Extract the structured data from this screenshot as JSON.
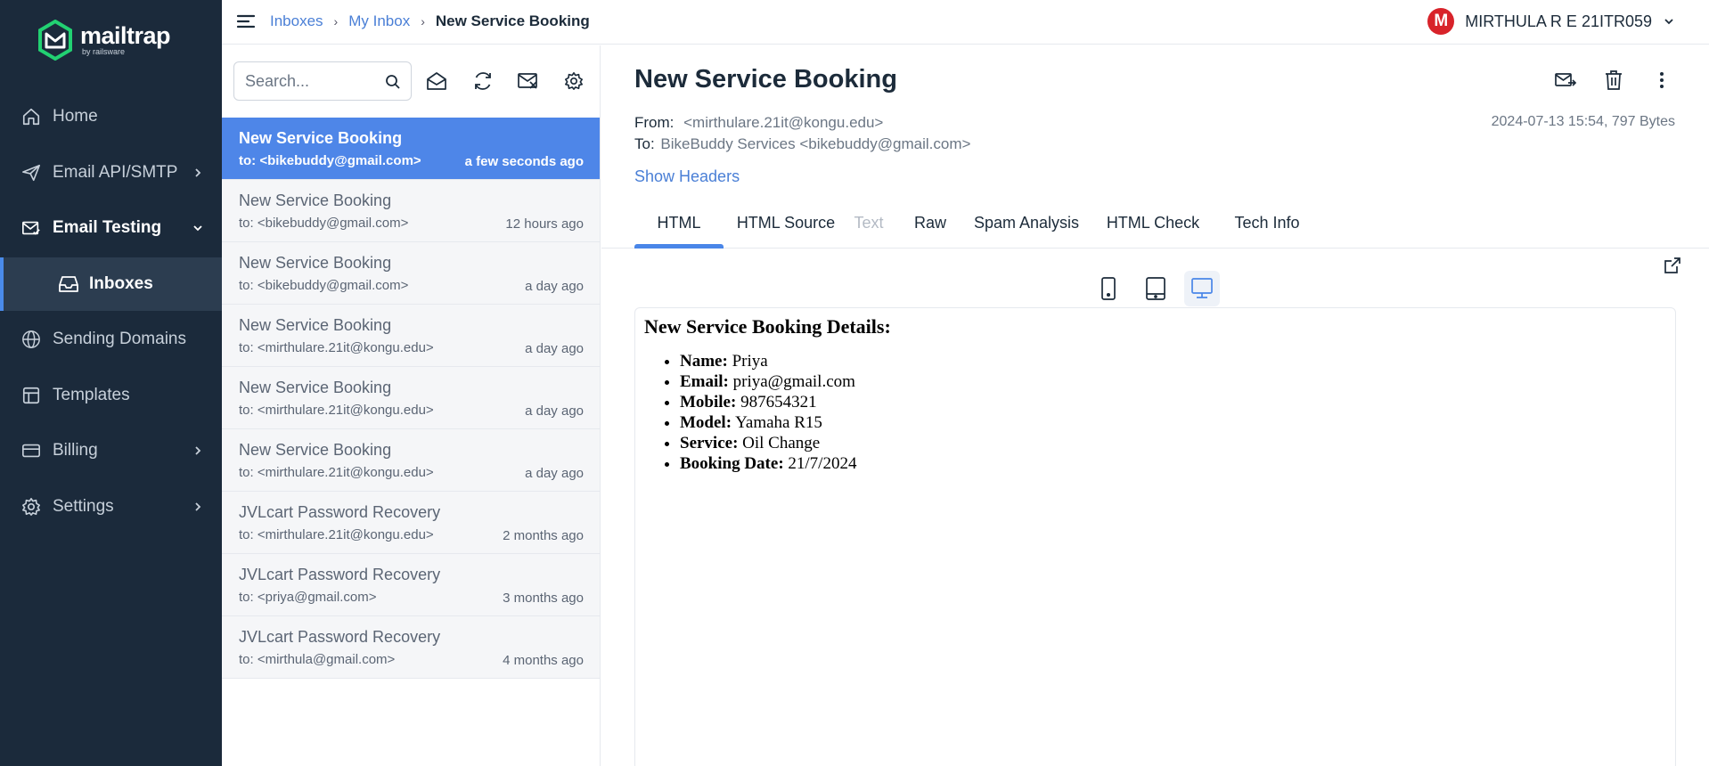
{
  "brand": {
    "name": "mailtrap",
    "sub": "by railsware",
    "color": "#22d172"
  },
  "sidebar": {
    "items": [
      {
        "label": "Home",
        "icon": "home-icon"
      },
      {
        "label": "Email API/SMTP",
        "icon": "send-icon"
      },
      {
        "label": "Email Testing",
        "icon": "mail-check-icon"
      },
      {
        "label": "Inboxes",
        "icon": "inbox-icon"
      },
      {
        "label": "Sending Domains",
        "icon": "globe-icon"
      },
      {
        "label": "Templates",
        "icon": "template-icon"
      },
      {
        "label": "Billing",
        "icon": "card-icon"
      },
      {
        "label": "Settings",
        "icon": "gear-icon"
      }
    ]
  },
  "topbar": {
    "breadcrumb": [
      "Inboxes",
      "My Inbox",
      "New Service Booking"
    ],
    "user": {
      "initial": "M",
      "name": "MIRTHULA R E 21ITR059",
      "avatar_color": "#d8232a"
    }
  },
  "list": {
    "search_placeholder": "Search...",
    "messages": [
      {
        "subject": "New Service Booking",
        "to": "to: <bikebuddy@gmail.com>",
        "time": "a few seconds ago",
        "selected": true
      },
      {
        "subject": "New Service Booking",
        "to": "to: <bikebuddy@gmail.com>",
        "time": "12 hours ago"
      },
      {
        "subject": "New Service Booking",
        "to": "to: <bikebuddy@gmail.com>",
        "time": "a day ago"
      },
      {
        "subject": "New Service Booking",
        "to": "to: <mirthulare.21it@kongu.edu>",
        "time": "a day ago"
      },
      {
        "subject": "New Service Booking",
        "to": "to: <mirthulare.21it@kongu.edu>",
        "time": "a day ago"
      },
      {
        "subject": "New Service Booking",
        "to": "to: <mirthulare.21it@kongu.edu>",
        "time": "a day ago"
      },
      {
        "subject": "JVLcart Password Recovery",
        "to": "to: <mirthulare.21it@kongu.edu>",
        "time": "2 months ago"
      },
      {
        "subject": "JVLcart Password Recovery",
        "to": "to: <priya@gmail.com>",
        "time": "3 months ago"
      },
      {
        "subject": "JVLcart Password Recovery",
        "to": "to: <mirthula@gmail.com>",
        "time": "4 months ago"
      }
    ]
  },
  "detail": {
    "title": "New Service Booking",
    "from_label": "From:",
    "from_value": "<mirthulare.21it@kongu.edu>",
    "to_label": "To:",
    "to_value": "BikeBuddy Services <bikebuddy@gmail.com>",
    "meta": "2024-07-13 15:54, 797 Bytes",
    "show_headers": "Show Headers",
    "tabs": [
      "HTML",
      "HTML Source",
      "Text",
      "Raw",
      "Spam Analysis",
      "HTML Check",
      "Tech Info"
    ],
    "active_tab": "HTML",
    "accent": "#4a86e8"
  },
  "email_body": {
    "heading": "New Service Booking Details:",
    "fields": [
      {
        "label": "Name:",
        "value": "Priya"
      },
      {
        "label": "Email:",
        "value": "priya@gmail.com"
      },
      {
        "label": "Mobile:",
        "value": "987654321"
      },
      {
        "label": "Model:",
        "value": "Yamaha R15"
      },
      {
        "label": "Service:",
        "value": "Oil Change"
      },
      {
        "label": "Booking Date:",
        "value": "21/7/2024"
      }
    ]
  }
}
